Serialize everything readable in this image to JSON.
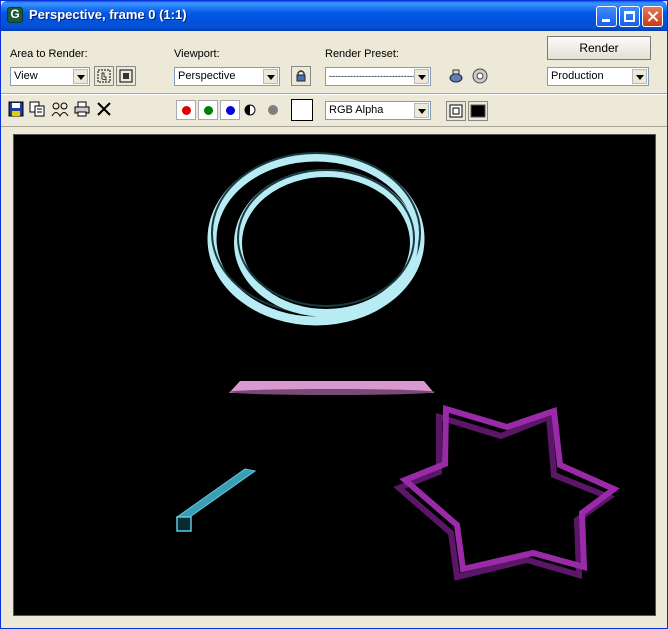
{
  "window": {
    "title": "Perspective, frame 0 (1:1)",
    "controls": [
      "minimize-icon",
      "maximize-icon",
      "close-icon"
    ]
  },
  "area_to_render": {
    "label": "Area to Render:",
    "value": "View"
  },
  "viewport_select": {
    "label": "Viewport:",
    "value": "Perspective"
  },
  "render_preset": {
    "label": "Render Preset:",
    "value": "------------------------------"
  },
  "render_button": {
    "label": "Render"
  },
  "production_select": {
    "value": "Production"
  },
  "toolbar": {
    "icons": [
      "save-icon",
      "copy-icon",
      "clone-icon",
      "print-icon",
      "clear-icon"
    ],
    "channels": {
      "red": "#e00000",
      "green": "#008000",
      "blue": "#0000e0",
      "mono": "#808080"
    },
    "channel_select": {
      "value": "RGB Alpha"
    }
  },
  "scene": {
    "colors": {
      "rings": "#b8ecf5",
      "disc": "#e6a0dc",
      "tube": "#3a9fb5",
      "star": "#9a2aa8"
    }
  }
}
